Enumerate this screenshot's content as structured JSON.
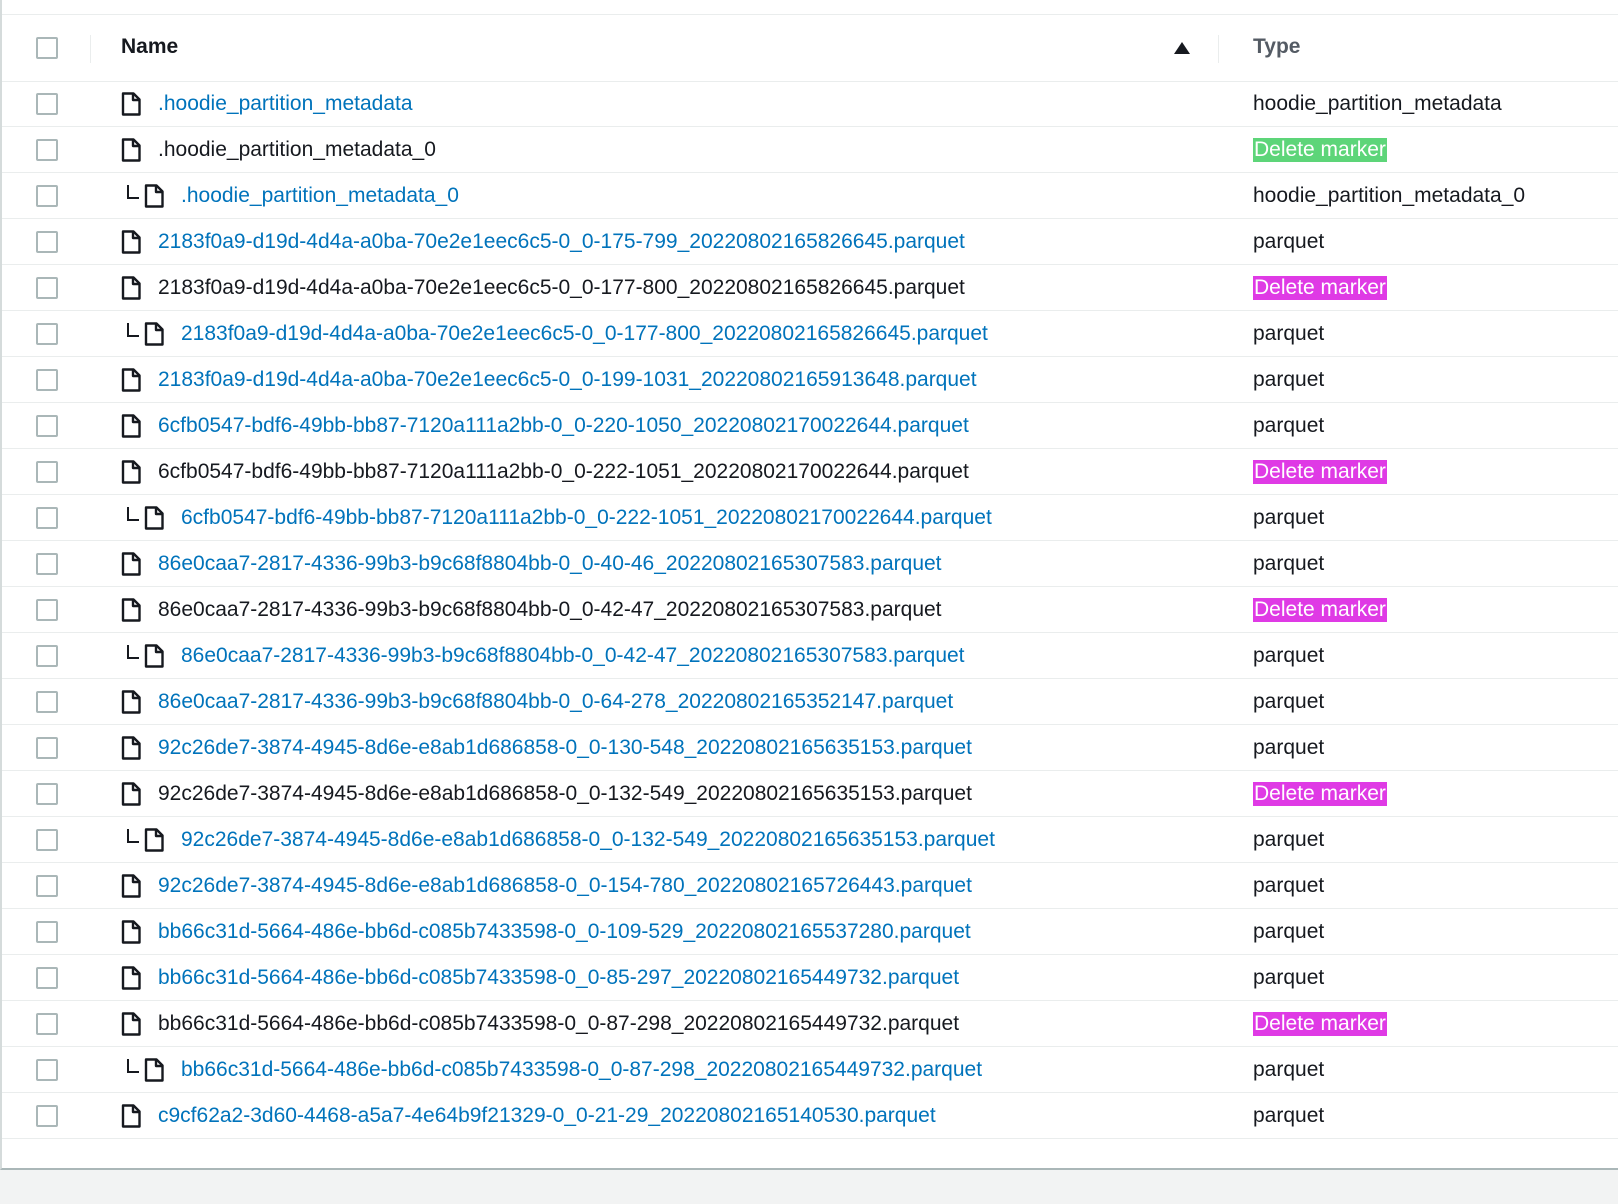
{
  "table": {
    "columns": {
      "name": "Name",
      "type": "Type"
    },
    "sort": {
      "column": "name",
      "direction": "ascending"
    },
    "colors": {
      "link": "#0073bb",
      "badge_green": "#5dd579",
      "badge_magenta": "#df3ae5"
    },
    "rows": [
      {
        "name": ".hoodie_partition_metadata",
        "type": "hoodie_partition_metadata",
        "link": true,
        "indent": false,
        "badge": ""
      },
      {
        "name": ".hoodie_partition_metadata_0",
        "type": "Delete marker",
        "link": false,
        "indent": false,
        "badge": "green"
      },
      {
        "name": ".hoodie_partition_metadata_0",
        "type": "hoodie_partition_metadata_0",
        "link": true,
        "indent": true,
        "badge": ""
      },
      {
        "name": "2183f0a9-d19d-4d4a-a0ba-70e2e1eec6c5-0_0-175-799_20220802165826645.parquet",
        "type": "parquet",
        "link": true,
        "indent": false,
        "badge": ""
      },
      {
        "name": "2183f0a9-d19d-4d4a-a0ba-70e2e1eec6c5-0_0-177-800_20220802165826645.parquet",
        "type": "Delete marker",
        "link": false,
        "indent": false,
        "badge": "magenta"
      },
      {
        "name": "2183f0a9-d19d-4d4a-a0ba-70e2e1eec6c5-0_0-177-800_20220802165826645.parquet",
        "type": "parquet",
        "link": true,
        "indent": true,
        "badge": ""
      },
      {
        "name": "2183f0a9-d19d-4d4a-a0ba-70e2e1eec6c5-0_0-199-1031_20220802165913648.parquet",
        "type": "parquet",
        "link": true,
        "indent": false,
        "badge": ""
      },
      {
        "name": "6cfb0547-bdf6-49bb-bb87-7120a111a2bb-0_0-220-1050_20220802170022644.parquet",
        "type": "parquet",
        "link": true,
        "indent": false,
        "badge": ""
      },
      {
        "name": "6cfb0547-bdf6-49bb-bb87-7120a111a2bb-0_0-222-1051_20220802170022644.parquet",
        "type": "Delete marker",
        "link": false,
        "indent": false,
        "badge": "magenta"
      },
      {
        "name": "6cfb0547-bdf6-49bb-bb87-7120a111a2bb-0_0-222-1051_20220802170022644.parquet",
        "type": "parquet",
        "link": true,
        "indent": true,
        "badge": ""
      },
      {
        "name": "86e0caa7-2817-4336-99b3-b9c68f8804bb-0_0-40-46_20220802165307583.parquet",
        "type": "parquet",
        "link": true,
        "indent": false,
        "badge": ""
      },
      {
        "name": "86e0caa7-2817-4336-99b3-b9c68f8804bb-0_0-42-47_20220802165307583.parquet",
        "type": "Delete marker",
        "link": false,
        "indent": false,
        "badge": "magenta"
      },
      {
        "name": "86e0caa7-2817-4336-99b3-b9c68f8804bb-0_0-42-47_20220802165307583.parquet",
        "type": "parquet",
        "link": true,
        "indent": true,
        "badge": ""
      },
      {
        "name": "86e0caa7-2817-4336-99b3-b9c68f8804bb-0_0-64-278_20220802165352147.parquet",
        "type": "parquet",
        "link": true,
        "indent": false,
        "badge": ""
      },
      {
        "name": "92c26de7-3874-4945-8d6e-e8ab1d686858-0_0-130-548_20220802165635153.parquet",
        "type": "parquet",
        "link": true,
        "indent": false,
        "badge": ""
      },
      {
        "name": "92c26de7-3874-4945-8d6e-e8ab1d686858-0_0-132-549_20220802165635153.parquet",
        "type": "Delete marker",
        "link": false,
        "indent": false,
        "badge": "magenta"
      },
      {
        "name": "92c26de7-3874-4945-8d6e-e8ab1d686858-0_0-132-549_20220802165635153.parquet",
        "type": "parquet",
        "link": true,
        "indent": true,
        "badge": ""
      },
      {
        "name": "92c26de7-3874-4945-8d6e-e8ab1d686858-0_0-154-780_20220802165726443.parquet",
        "type": "parquet",
        "link": true,
        "indent": false,
        "badge": ""
      },
      {
        "name": "bb66c31d-5664-486e-bb6d-c085b7433598-0_0-109-529_20220802165537280.parquet",
        "type": "parquet",
        "link": true,
        "indent": false,
        "badge": ""
      },
      {
        "name": "bb66c31d-5664-486e-bb6d-c085b7433598-0_0-85-297_20220802165449732.parquet",
        "type": "parquet",
        "link": true,
        "indent": false,
        "badge": ""
      },
      {
        "name": "bb66c31d-5664-486e-bb6d-c085b7433598-0_0-87-298_20220802165449732.parquet",
        "type": "Delete marker",
        "link": false,
        "indent": false,
        "badge": "magenta"
      },
      {
        "name": "bb66c31d-5664-486e-bb6d-c085b7433598-0_0-87-298_20220802165449732.parquet",
        "type": "parquet",
        "link": true,
        "indent": true,
        "badge": ""
      },
      {
        "name": "c9cf62a2-3d60-4468-a5a7-4e64b9f21329-0_0-21-29_20220802165140530.parquet",
        "type": "parquet",
        "link": true,
        "indent": false,
        "badge": ""
      }
    ]
  }
}
